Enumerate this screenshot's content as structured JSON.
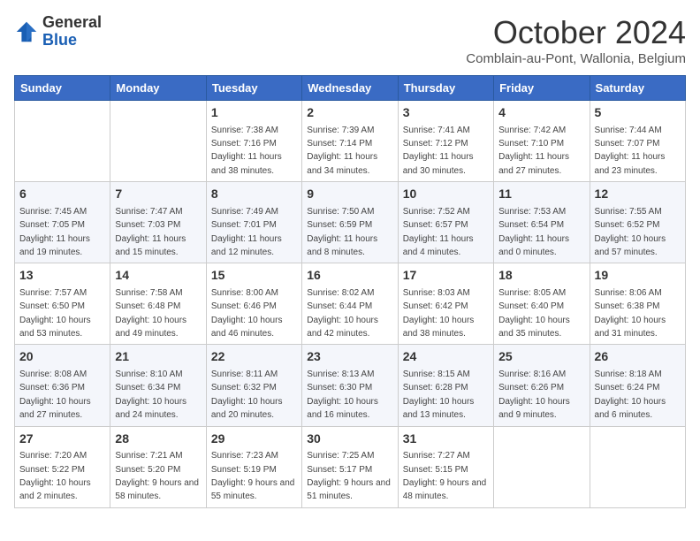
{
  "header": {
    "logo_general": "General",
    "logo_blue": "Blue",
    "month_title": "October 2024",
    "subtitle": "Comblain-au-Pont, Wallonia, Belgium"
  },
  "columns": [
    "Sunday",
    "Monday",
    "Tuesday",
    "Wednesday",
    "Thursday",
    "Friday",
    "Saturday"
  ],
  "weeks": [
    [
      {
        "day": "",
        "info": ""
      },
      {
        "day": "",
        "info": ""
      },
      {
        "day": "1",
        "info": "Sunrise: 7:38 AM\nSunset: 7:16 PM\nDaylight: 11 hours and 38 minutes."
      },
      {
        "day": "2",
        "info": "Sunrise: 7:39 AM\nSunset: 7:14 PM\nDaylight: 11 hours and 34 minutes."
      },
      {
        "day": "3",
        "info": "Sunrise: 7:41 AM\nSunset: 7:12 PM\nDaylight: 11 hours and 30 minutes."
      },
      {
        "day": "4",
        "info": "Sunrise: 7:42 AM\nSunset: 7:10 PM\nDaylight: 11 hours and 27 minutes."
      },
      {
        "day": "5",
        "info": "Sunrise: 7:44 AM\nSunset: 7:07 PM\nDaylight: 11 hours and 23 minutes."
      }
    ],
    [
      {
        "day": "6",
        "info": "Sunrise: 7:45 AM\nSunset: 7:05 PM\nDaylight: 11 hours and 19 minutes."
      },
      {
        "day": "7",
        "info": "Sunrise: 7:47 AM\nSunset: 7:03 PM\nDaylight: 11 hours and 15 minutes."
      },
      {
        "day": "8",
        "info": "Sunrise: 7:49 AM\nSunset: 7:01 PM\nDaylight: 11 hours and 12 minutes."
      },
      {
        "day": "9",
        "info": "Sunrise: 7:50 AM\nSunset: 6:59 PM\nDaylight: 11 hours and 8 minutes."
      },
      {
        "day": "10",
        "info": "Sunrise: 7:52 AM\nSunset: 6:57 PM\nDaylight: 11 hours and 4 minutes."
      },
      {
        "day": "11",
        "info": "Sunrise: 7:53 AM\nSunset: 6:54 PM\nDaylight: 11 hours and 0 minutes."
      },
      {
        "day": "12",
        "info": "Sunrise: 7:55 AM\nSunset: 6:52 PM\nDaylight: 10 hours and 57 minutes."
      }
    ],
    [
      {
        "day": "13",
        "info": "Sunrise: 7:57 AM\nSunset: 6:50 PM\nDaylight: 10 hours and 53 minutes."
      },
      {
        "day": "14",
        "info": "Sunrise: 7:58 AM\nSunset: 6:48 PM\nDaylight: 10 hours and 49 minutes."
      },
      {
        "day": "15",
        "info": "Sunrise: 8:00 AM\nSunset: 6:46 PM\nDaylight: 10 hours and 46 minutes."
      },
      {
        "day": "16",
        "info": "Sunrise: 8:02 AM\nSunset: 6:44 PM\nDaylight: 10 hours and 42 minutes."
      },
      {
        "day": "17",
        "info": "Sunrise: 8:03 AM\nSunset: 6:42 PM\nDaylight: 10 hours and 38 minutes."
      },
      {
        "day": "18",
        "info": "Sunrise: 8:05 AM\nSunset: 6:40 PM\nDaylight: 10 hours and 35 minutes."
      },
      {
        "day": "19",
        "info": "Sunrise: 8:06 AM\nSunset: 6:38 PM\nDaylight: 10 hours and 31 minutes."
      }
    ],
    [
      {
        "day": "20",
        "info": "Sunrise: 8:08 AM\nSunset: 6:36 PM\nDaylight: 10 hours and 27 minutes."
      },
      {
        "day": "21",
        "info": "Sunrise: 8:10 AM\nSunset: 6:34 PM\nDaylight: 10 hours and 24 minutes."
      },
      {
        "day": "22",
        "info": "Sunrise: 8:11 AM\nSunset: 6:32 PM\nDaylight: 10 hours and 20 minutes."
      },
      {
        "day": "23",
        "info": "Sunrise: 8:13 AM\nSunset: 6:30 PM\nDaylight: 10 hours and 16 minutes."
      },
      {
        "day": "24",
        "info": "Sunrise: 8:15 AM\nSunset: 6:28 PM\nDaylight: 10 hours and 13 minutes."
      },
      {
        "day": "25",
        "info": "Sunrise: 8:16 AM\nSunset: 6:26 PM\nDaylight: 10 hours and 9 minutes."
      },
      {
        "day": "26",
        "info": "Sunrise: 8:18 AM\nSunset: 6:24 PM\nDaylight: 10 hours and 6 minutes."
      }
    ],
    [
      {
        "day": "27",
        "info": "Sunrise: 7:20 AM\nSunset: 5:22 PM\nDaylight: 10 hours and 2 minutes."
      },
      {
        "day": "28",
        "info": "Sunrise: 7:21 AM\nSunset: 5:20 PM\nDaylight: 9 hours and 58 minutes."
      },
      {
        "day": "29",
        "info": "Sunrise: 7:23 AM\nSunset: 5:19 PM\nDaylight: 9 hours and 55 minutes."
      },
      {
        "day": "30",
        "info": "Sunrise: 7:25 AM\nSunset: 5:17 PM\nDaylight: 9 hours and 51 minutes."
      },
      {
        "day": "31",
        "info": "Sunrise: 7:27 AM\nSunset: 5:15 PM\nDaylight: 9 hours and 48 minutes."
      },
      {
        "day": "",
        "info": ""
      },
      {
        "day": "",
        "info": ""
      }
    ]
  ]
}
